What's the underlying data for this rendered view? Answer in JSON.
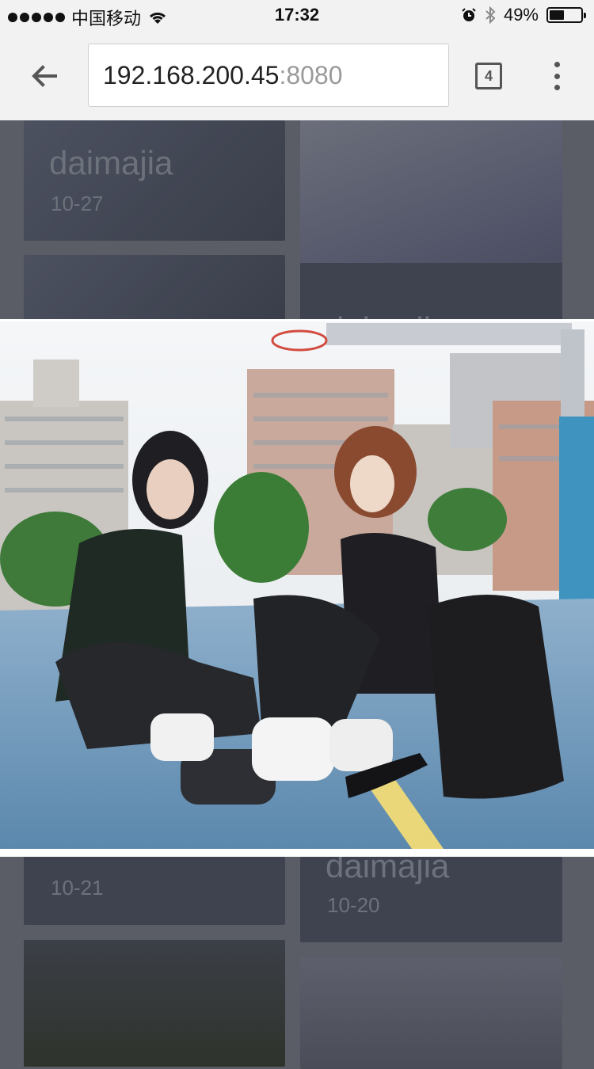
{
  "status_bar": {
    "carrier": "中国移动",
    "time": "17:32",
    "battery_percent": "49%",
    "battery_level": 0.49
  },
  "browser": {
    "url_host": "192.168.200.45",
    "url_port": ":8080",
    "tab_count": "4"
  },
  "gallery": {
    "cards": [
      {
        "title": "daimajia",
        "date": "10-27"
      },
      {
        "title": "",
        "date": ""
      },
      {
        "title": "",
        "date": ""
      },
      {
        "title": "daimajia",
        "date": ""
      },
      {
        "title": "",
        "date": "10-21"
      },
      {
        "title": "daimajia",
        "date": "10-20"
      },
      {
        "title": "",
        "date": ""
      },
      {
        "title": "",
        "date": ""
      }
    ]
  },
  "colors": {
    "overlay": "#5a5d66",
    "court": "#5b88ad",
    "toolbar": "#f2f2f2"
  }
}
